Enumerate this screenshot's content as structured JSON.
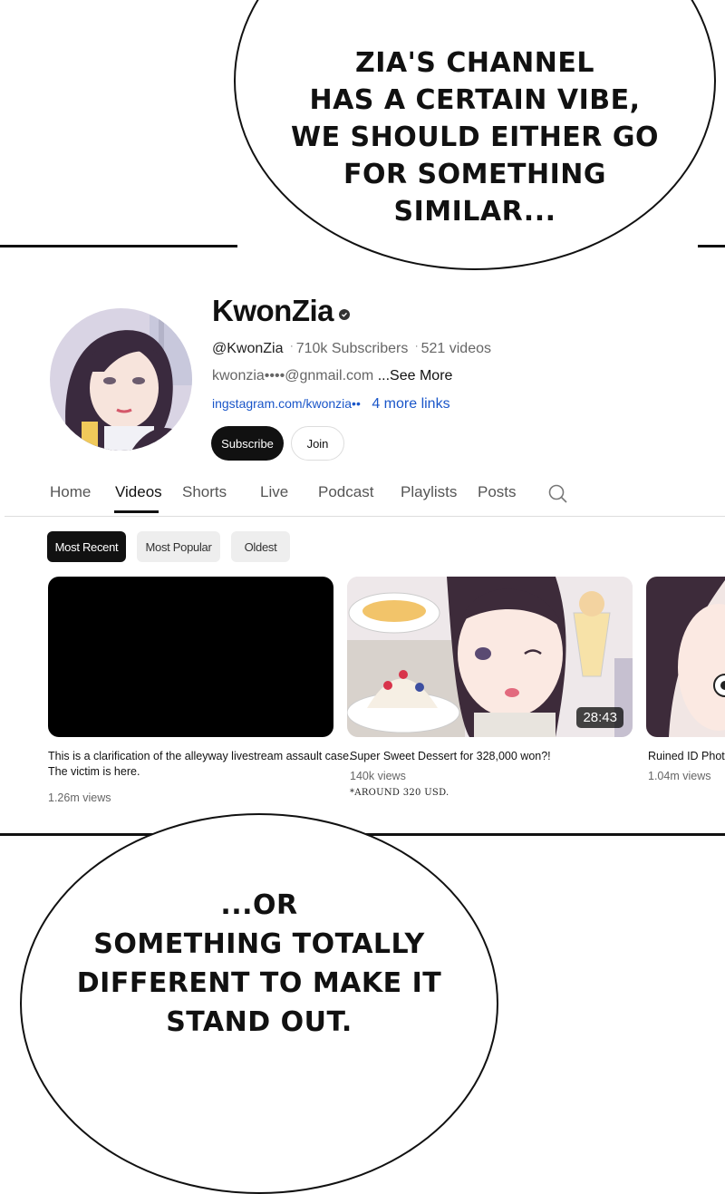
{
  "top_bubble": {
    "text": "ZIA'S CHANNEL\nHAS A CERTAIN VIBE,\nWE SHOULD EITHER GO\nFOR SOMETHING\nSIMILAR..."
  },
  "bottom_bubble": {
    "text": "...OR\nSOMETHING TOTALLY\nDIFFERENT TO MAKE IT\nSTAND OUT."
  },
  "channel": {
    "name": "KwonZia",
    "handle": "@KwonZia",
    "subscribers": "710k Subscribers",
    "videos_count": "521 videos",
    "email": "kwonzia••••@gnmail.com",
    "see_more": "...See More",
    "link": "ingstagram.com/kwonzia••",
    "more_links": "4 more links",
    "subscribe_label": "Subscribe",
    "join_label": "Join",
    "colors": {
      "link": "#1a56c9",
      "subscribe_bg": "#111111"
    }
  },
  "tabs": [
    {
      "label": "Home"
    },
    {
      "label": "Videos",
      "active": true
    },
    {
      "label": "Shorts"
    },
    {
      "label": "Live"
    },
    {
      "label": "Podcast"
    },
    {
      "label": "Playlists"
    },
    {
      "label": "Posts"
    }
  ],
  "search_icon": "search-icon",
  "filters": [
    {
      "label": "Most Recent",
      "selected": true
    },
    {
      "label": "Most Popular"
    },
    {
      "label": "Oldest"
    }
  ],
  "videos": [
    {
      "title_line1": "This is a clarification of the alleyway livestream assault case.",
      "title_line2": "The victim is here.",
      "views": "1.26m views"
    },
    {
      "title_line1": "Super Sweet Dessert for 328,000 won?!",
      "views": "140k views",
      "duration": "28:43",
      "footnote": "*AROUND 320 USD."
    },
    {
      "title_line1": "Ruined ID Photo",
      "views": "1.04m views"
    }
  ]
}
